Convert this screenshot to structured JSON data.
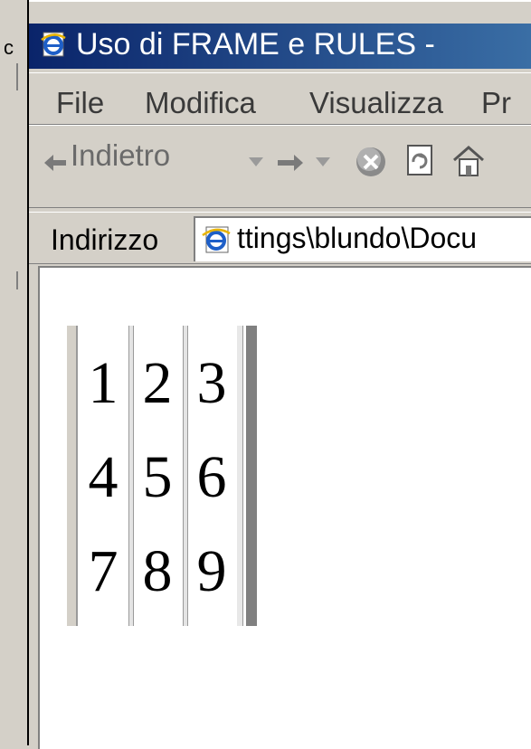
{
  "window": {
    "title": "Uso di FRAME e RULES -"
  },
  "menu": [
    "File",
    "Modifica",
    "Visualizza",
    "Pr"
  ],
  "toolbar": {
    "back_label": "Indietro"
  },
  "address": {
    "label": "Indirizzo",
    "value": "ttings\\blundo\\Docu"
  },
  "table": {
    "rows": [
      [
        "1",
        "2",
        "3"
      ],
      [
        "4",
        "5",
        "6"
      ],
      [
        "7",
        "8",
        "9"
      ]
    ]
  },
  "colors": {
    "titlebar": "#0a246a",
    "chrome": "#d4d0c8"
  },
  "icons": [
    "ie-page-icon",
    "back-arrow-icon",
    "dropdown-icon",
    "forward-arrow-icon",
    "stop-icon",
    "refresh-icon",
    "home-icon"
  ]
}
